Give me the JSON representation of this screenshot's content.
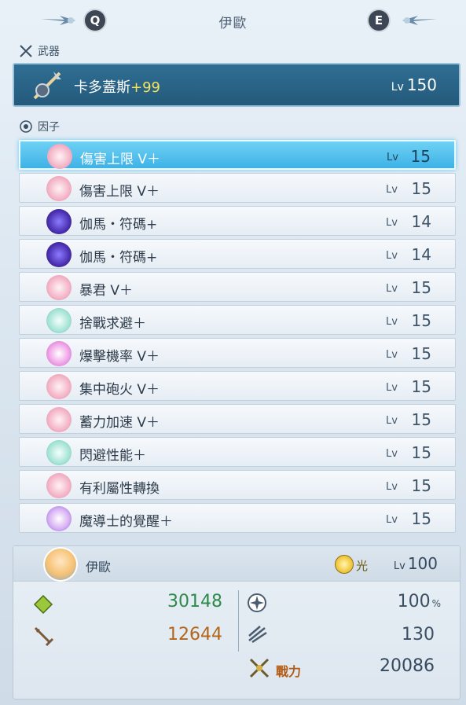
{
  "header": {
    "title": "伊歐",
    "key_left": "Q",
    "key_right": "E"
  },
  "weapon_section": {
    "label": "武器"
  },
  "weapon": {
    "name": "卡多蓋斯",
    "plus": "+99",
    "lv_label": "Lv",
    "level": "150"
  },
  "factor_section": {
    "label": "因子"
  },
  "factors": [
    {
      "name": "傷害上限 V＋",
      "lv_label": "Lv",
      "level": "15",
      "icon": "pink-crown-icon"
    },
    {
      "name": "傷害上限 V＋",
      "lv_label": "Lv",
      "level": "15",
      "icon": "pink-crown-icon"
    },
    {
      "name": "伽馬・符碼+",
      "lv_label": "Lv",
      "level": "14",
      "icon": "purple-star-icon"
    },
    {
      "name": "伽馬・符碼+",
      "lv_label": "Lv",
      "level": "14",
      "icon": "purple-star-icon"
    },
    {
      "name": "暴君 V＋",
      "lv_label": "Lv",
      "level": "15",
      "icon": "pink-crown-icon"
    },
    {
      "name": "捨戰求避＋",
      "lv_label": "Lv",
      "level": "15",
      "icon": "teal-rune-icon"
    },
    {
      "name": "爆擊機率 V＋",
      "lv_label": "Lv",
      "level": "15",
      "icon": "magenta-target-icon"
    },
    {
      "name": "集中砲火 V＋",
      "lv_label": "Lv",
      "level": "15",
      "icon": "pink-crown-icon"
    },
    {
      "name": "蓄力加速 V＋",
      "lv_label": "Lv",
      "level": "15",
      "icon": "pink-crown-icon"
    },
    {
      "name": "閃避性能＋",
      "lv_label": "Lv",
      "level": "15",
      "icon": "teal-rune-icon"
    },
    {
      "name": "有利屬性轉換",
      "lv_label": "Lv",
      "level": "15",
      "icon": "pink-crown-icon"
    },
    {
      "name": "魔導士的覺醒＋",
      "lv_label": "Lv",
      "level": "15",
      "icon": "violet-star-icon"
    }
  ],
  "character": {
    "name": "伊歐",
    "element": "光",
    "lv_label": "Lv",
    "level": "100",
    "hp": "30148",
    "atk": "12644",
    "crit": "100",
    "crit_unit": "%",
    "damage": "130",
    "power_label": "戰力",
    "power": "20086"
  },
  "colors": {
    "hp": "#2d8a48",
    "atk": "#b3661a",
    "weapon_bg": "#2f6e93",
    "active_row": "#3eb2e6"
  }
}
